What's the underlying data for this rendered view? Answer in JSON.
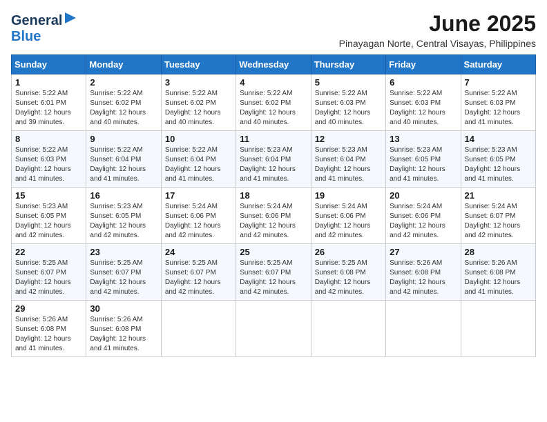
{
  "logo": {
    "general": "General",
    "blue": "Blue"
  },
  "header": {
    "month_year": "June 2025",
    "location": "Pinayagan Norte, Central Visayas, Philippines"
  },
  "days_of_week": [
    "Sunday",
    "Monday",
    "Tuesday",
    "Wednesday",
    "Thursday",
    "Friday",
    "Saturday"
  ],
  "weeks": [
    [
      {
        "day": "1",
        "sunrise": "Sunrise: 5:22 AM",
        "sunset": "Sunset: 6:01 PM",
        "daylight": "Daylight: 12 hours and 39 minutes."
      },
      {
        "day": "2",
        "sunrise": "Sunrise: 5:22 AM",
        "sunset": "Sunset: 6:02 PM",
        "daylight": "Daylight: 12 hours and 40 minutes."
      },
      {
        "day": "3",
        "sunrise": "Sunrise: 5:22 AM",
        "sunset": "Sunset: 6:02 PM",
        "daylight": "Daylight: 12 hours and 40 minutes."
      },
      {
        "day": "4",
        "sunrise": "Sunrise: 5:22 AM",
        "sunset": "Sunset: 6:02 PM",
        "daylight": "Daylight: 12 hours and 40 minutes."
      },
      {
        "day": "5",
        "sunrise": "Sunrise: 5:22 AM",
        "sunset": "Sunset: 6:03 PM",
        "daylight": "Daylight: 12 hours and 40 minutes."
      },
      {
        "day": "6",
        "sunrise": "Sunrise: 5:22 AM",
        "sunset": "Sunset: 6:03 PM",
        "daylight": "Daylight: 12 hours and 40 minutes."
      },
      {
        "day": "7",
        "sunrise": "Sunrise: 5:22 AM",
        "sunset": "Sunset: 6:03 PM",
        "daylight": "Daylight: 12 hours and 41 minutes."
      }
    ],
    [
      {
        "day": "8",
        "sunrise": "Sunrise: 5:22 AM",
        "sunset": "Sunset: 6:03 PM",
        "daylight": "Daylight: 12 hours and 41 minutes."
      },
      {
        "day": "9",
        "sunrise": "Sunrise: 5:22 AM",
        "sunset": "Sunset: 6:04 PM",
        "daylight": "Daylight: 12 hours and 41 minutes."
      },
      {
        "day": "10",
        "sunrise": "Sunrise: 5:22 AM",
        "sunset": "Sunset: 6:04 PM",
        "daylight": "Daylight: 12 hours and 41 minutes."
      },
      {
        "day": "11",
        "sunrise": "Sunrise: 5:23 AM",
        "sunset": "Sunset: 6:04 PM",
        "daylight": "Daylight: 12 hours and 41 minutes."
      },
      {
        "day": "12",
        "sunrise": "Sunrise: 5:23 AM",
        "sunset": "Sunset: 6:04 PM",
        "daylight": "Daylight: 12 hours and 41 minutes."
      },
      {
        "day": "13",
        "sunrise": "Sunrise: 5:23 AM",
        "sunset": "Sunset: 6:05 PM",
        "daylight": "Daylight: 12 hours and 41 minutes."
      },
      {
        "day": "14",
        "sunrise": "Sunrise: 5:23 AM",
        "sunset": "Sunset: 6:05 PM",
        "daylight": "Daylight: 12 hours and 41 minutes."
      }
    ],
    [
      {
        "day": "15",
        "sunrise": "Sunrise: 5:23 AM",
        "sunset": "Sunset: 6:05 PM",
        "daylight": "Daylight: 12 hours and 42 minutes."
      },
      {
        "day": "16",
        "sunrise": "Sunrise: 5:23 AM",
        "sunset": "Sunset: 6:05 PM",
        "daylight": "Daylight: 12 hours and 42 minutes."
      },
      {
        "day": "17",
        "sunrise": "Sunrise: 5:24 AM",
        "sunset": "Sunset: 6:06 PM",
        "daylight": "Daylight: 12 hours and 42 minutes."
      },
      {
        "day": "18",
        "sunrise": "Sunrise: 5:24 AM",
        "sunset": "Sunset: 6:06 PM",
        "daylight": "Daylight: 12 hours and 42 minutes."
      },
      {
        "day": "19",
        "sunrise": "Sunrise: 5:24 AM",
        "sunset": "Sunset: 6:06 PM",
        "daylight": "Daylight: 12 hours and 42 minutes."
      },
      {
        "day": "20",
        "sunrise": "Sunrise: 5:24 AM",
        "sunset": "Sunset: 6:06 PM",
        "daylight": "Daylight: 12 hours and 42 minutes."
      },
      {
        "day": "21",
        "sunrise": "Sunrise: 5:24 AM",
        "sunset": "Sunset: 6:07 PM",
        "daylight": "Daylight: 12 hours and 42 minutes."
      }
    ],
    [
      {
        "day": "22",
        "sunrise": "Sunrise: 5:25 AM",
        "sunset": "Sunset: 6:07 PM",
        "daylight": "Daylight: 12 hours and 42 minutes."
      },
      {
        "day": "23",
        "sunrise": "Sunrise: 5:25 AM",
        "sunset": "Sunset: 6:07 PM",
        "daylight": "Daylight: 12 hours and 42 minutes."
      },
      {
        "day": "24",
        "sunrise": "Sunrise: 5:25 AM",
        "sunset": "Sunset: 6:07 PM",
        "daylight": "Daylight: 12 hours and 42 minutes."
      },
      {
        "day": "25",
        "sunrise": "Sunrise: 5:25 AM",
        "sunset": "Sunset: 6:07 PM",
        "daylight": "Daylight: 12 hours and 42 minutes."
      },
      {
        "day": "26",
        "sunrise": "Sunrise: 5:25 AM",
        "sunset": "Sunset: 6:08 PM",
        "daylight": "Daylight: 12 hours and 42 minutes."
      },
      {
        "day": "27",
        "sunrise": "Sunrise: 5:26 AM",
        "sunset": "Sunset: 6:08 PM",
        "daylight": "Daylight: 12 hours and 42 minutes."
      },
      {
        "day": "28",
        "sunrise": "Sunrise: 5:26 AM",
        "sunset": "Sunset: 6:08 PM",
        "daylight": "Daylight: 12 hours and 41 minutes."
      }
    ],
    [
      {
        "day": "29",
        "sunrise": "Sunrise: 5:26 AM",
        "sunset": "Sunset: 6:08 PM",
        "daylight": "Daylight: 12 hours and 41 minutes."
      },
      {
        "day": "30",
        "sunrise": "Sunrise: 5:26 AM",
        "sunset": "Sunset: 6:08 PM",
        "daylight": "Daylight: 12 hours and 41 minutes."
      },
      null,
      null,
      null,
      null,
      null
    ]
  ]
}
